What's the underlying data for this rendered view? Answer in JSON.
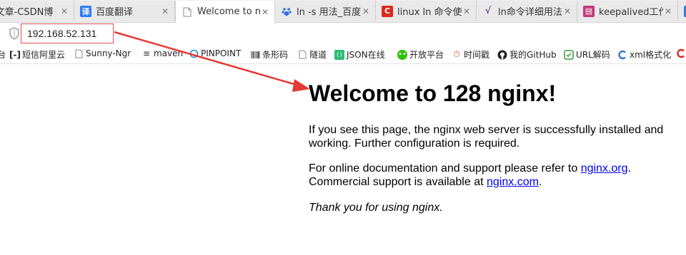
{
  "tabs": [
    {
      "title": "i文章-CSDN博",
      "icon": "csdn-icon",
      "icon_color": "#888888",
      "active": false
    },
    {
      "title": "百度翻译",
      "icon": "translate-icon",
      "icon_color": "#2e7cf6",
      "active": false
    },
    {
      "title": "Welcome to n",
      "icon": "page-icon",
      "icon_color": "#999999",
      "active": true
    },
    {
      "title": "ln -s 用法_百度",
      "icon": "baidu-paw-icon",
      "icon_color": "#2e6be6",
      "active": false
    },
    {
      "title": "linux ln 命令使",
      "icon": "csdn-c-icon",
      "icon_color": "#d9291c",
      "active": false
    },
    {
      "title": "ln命令详细用法",
      "icon": "script-icon",
      "icon_color": "#6a4e9e",
      "active": false
    },
    {
      "title": "keepalived工作",
      "icon": "bookmark-doc-icon",
      "icon_color": "#c43a7a",
      "active": false
    },
    {
      "title": "",
      "icon": "cnblogs-icon",
      "icon_color": "#3a7bd5",
      "active": false
    }
  ],
  "address_bar": {
    "url": "192.168.52.131"
  },
  "bookmarks": [
    {
      "label": "台",
      "icon": "folder-icon",
      "icon_color": "#555555"
    },
    {
      "label": "短信阿里云",
      "icon": "aliyun-icon",
      "icon_color": "#333333"
    },
    {
      "label": "Sunny-Ngr",
      "icon": "page-icon",
      "icon_color": "#888888"
    },
    {
      "label": "maven",
      "icon": "maven-icon",
      "icon_color": "#333333"
    },
    {
      "label": "PINPOINT",
      "icon": "pinpoint-icon",
      "icon_color": "#1f8dd6"
    },
    {
      "label": "条形码",
      "icon": "barcode-icon",
      "icon_color": "#333333"
    },
    {
      "label": "隧道",
      "icon": "page-icon",
      "icon_color": "#888888"
    },
    {
      "label": "JSON在线",
      "icon": "json-icon",
      "icon_color": "#2dbb73"
    },
    {
      "label": "开放平台",
      "icon": "wechat-icon",
      "icon_color": "#2dc100"
    },
    {
      "label": "时间戳",
      "icon": "timestamp-icon",
      "icon_color": "#d04a2a"
    },
    {
      "label": "我的GitHub",
      "icon": "github-icon",
      "icon_color": "#222222"
    },
    {
      "label": "URL解码",
      "icon": "url-decode-icon",
      "icon_color": "#3a9a3a"
    },
    {
      "label": "xml格式化",
      "icon": "xml-icon",
      "icon_color": "#2a6ad8"
    },
    {
      "label": "",
      "icon": "red-c-icon",
      "icon_color": "#d9291c"
    }
  ],
  "page": {
    "heading": "Welcome to 128 nginx!",
    "para1": "If you see this page, the nginx web server is successfully installed and working. Further configuration is required.",
    "para2_text1": "For online documentation and support please refer to ",
    "para2_link1": "nginx.org",
    "para2_text2": ".",
    "para2_text3": "Commercial support is available at ",
    "para2_link2": "nginx.com",
    "para2_text4": ".",
    "para3": "Thank you for using nginx."
  },
  "colors": {
    "annotation_red": "#e53935",
    "link": "#0000ee"
  }
}
